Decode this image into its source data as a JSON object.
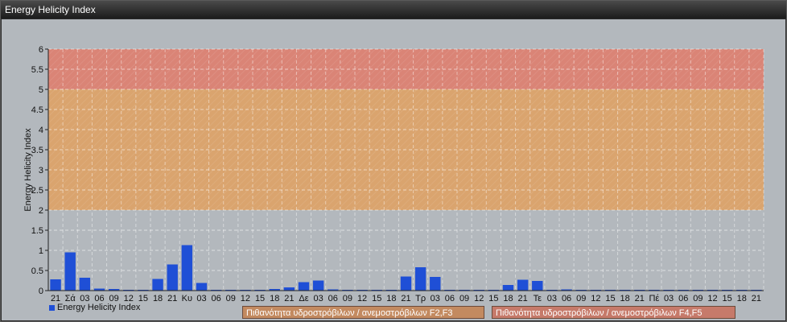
{
  "window": {
    "title": "Energy Helicity Index"
  },
  "chart_data": {
    "type": "bar",
    "title": "",
    "xlabel": "",
    "ylabel": "Energy Helicity Index",
    "ylim": [
      0,
      6
    ],
    "yticks": [
      "0",
      "0.5",
      "1",
      "1.5",
      "2",
      "2.5",
      "3",
      "3.5",
      "4",
      "4.5",
      "5",
      "5.5",
      "6"
    ],
    "grid": true,
    "legend_position": "bottom-left",
    "categories": [
      "21",
      "Σά",
      "03",
      "06",
      "09",
      "12",
      "15",
      "18",
      "21",
      "Κυ",
      "03",
      "06",
      "09",
      "12",
      "15",
      "18",
      "21",
      "Δε",
      "03",
      "06",
      "09",
      "12",
      "15",
      "18",
      "21",
      "Τρ",
      "03",
      "06",
      "09",
      "12",
      "15",
      "18",
      "21",
      "Τε",
      "03",
      "06",
      "09",
      "12",
      "15",
      "18",
      "21",
      "Πέ",
      "03",
      "06",
      "09",
      "12",
      "15",
      "18",
      "21"
    ],
    "series": [
      {
        "name": "Energy Helicity Index",
        "color": "#1f4fd6",
        "values": [
          0.28,
          0.95,
          0.32,
          0.05,
          0.04,
          0.02,
          0.02,
          0.29,
          0.65,
          1.13,
          0.19,
          0.02,
          0.02,
          0.02,
          0.02,
          0.04,
          0.08,
          0.21,
          0.25,
          0.03,
          0.02,
          0.02,
          0.02,
          0.02,
          0.35,
          0.58,
          0.34,
          0.02,
          0.02,
          0.02,
          0.02,
          0.14,
          0.27,
          0.24,
          0.02,
          0.03,
          0.02,
          0.02,
          0.02,
          0.02,
          0.02,
          0.02,
          0.02,
          0.02,
          0.02,
          0.02,
          0.02,
          0.02,
          0.02
        ]
      }
    ],
    "bands": [
      {
        "label": "Πιθανότητα υδροστρόβιλων / ανεμοστρόβιλων F2,F3",
        "from": 2,
        "to": 5,
        "color": "#e0a060"
      },
      {
        "label": "Πιθανότητα υδροστρόβιλων / ανεμοστρόβιλων F4,F5",
        "from": 5,
        "to": 6,
        "color": "#e07a6a"
      }
    ]
  }
}
